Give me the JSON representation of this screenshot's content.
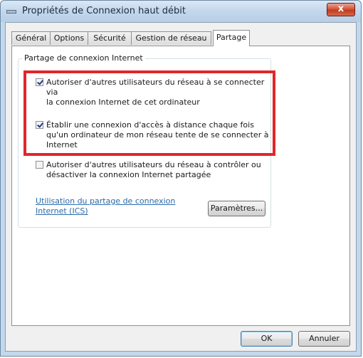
{
  "window": {
    "title": "Propriétés de Connexion haut débit",
    "close_label": "x"
  },
  "tabs": [
    {
      "label": "Général"
    },
    {
      "label": "Options"
    },
    {
      "label": "Sécurité"
    },
    {
      "label": "Gestion de réseau"
    },
    {
      "label": "Partage",
      "active": true
    }
  ],
  "group": {
    "label": "Partage de connexion Internet",
    "options": [
      {
        "line1": "Autoriser d'autres utilisateurs du réseau à se connecter via",
        "line2": "la connexion Internet de cet ordinateur",
        "checked": true
      },
      {
        "line1": "Établir une connexion d'accès à distance chaque fois",
        "line2": "qu'un ordinateur de mon réseau tente de se connecter à",
        "line3": "Internet",
        "checked": true
      },
      {
        "line1": "Autoriser d'autres utilisateurs du réseau à contrôler ou",
        "line2": "désactiver la connexion Internet partagée",
        "checked": false
      }
    ]
  },
  "link": {
    "text": "Utilisation du partage de connexion Internet (ICS)"
  },
  "buttons": {
    "settings": "Paramètres...",
    "ok": "OK",
    "cancel": "Annuler"
  },
  "colors": {
    "highlight": "#e2262b",
    "link": "#2b6aa9",
    "close_button": "#c13a20"
  },
  "icons": {
    "title": "network-connection-icon",
    "checkmark": "checkmark-icon"
  }
}
